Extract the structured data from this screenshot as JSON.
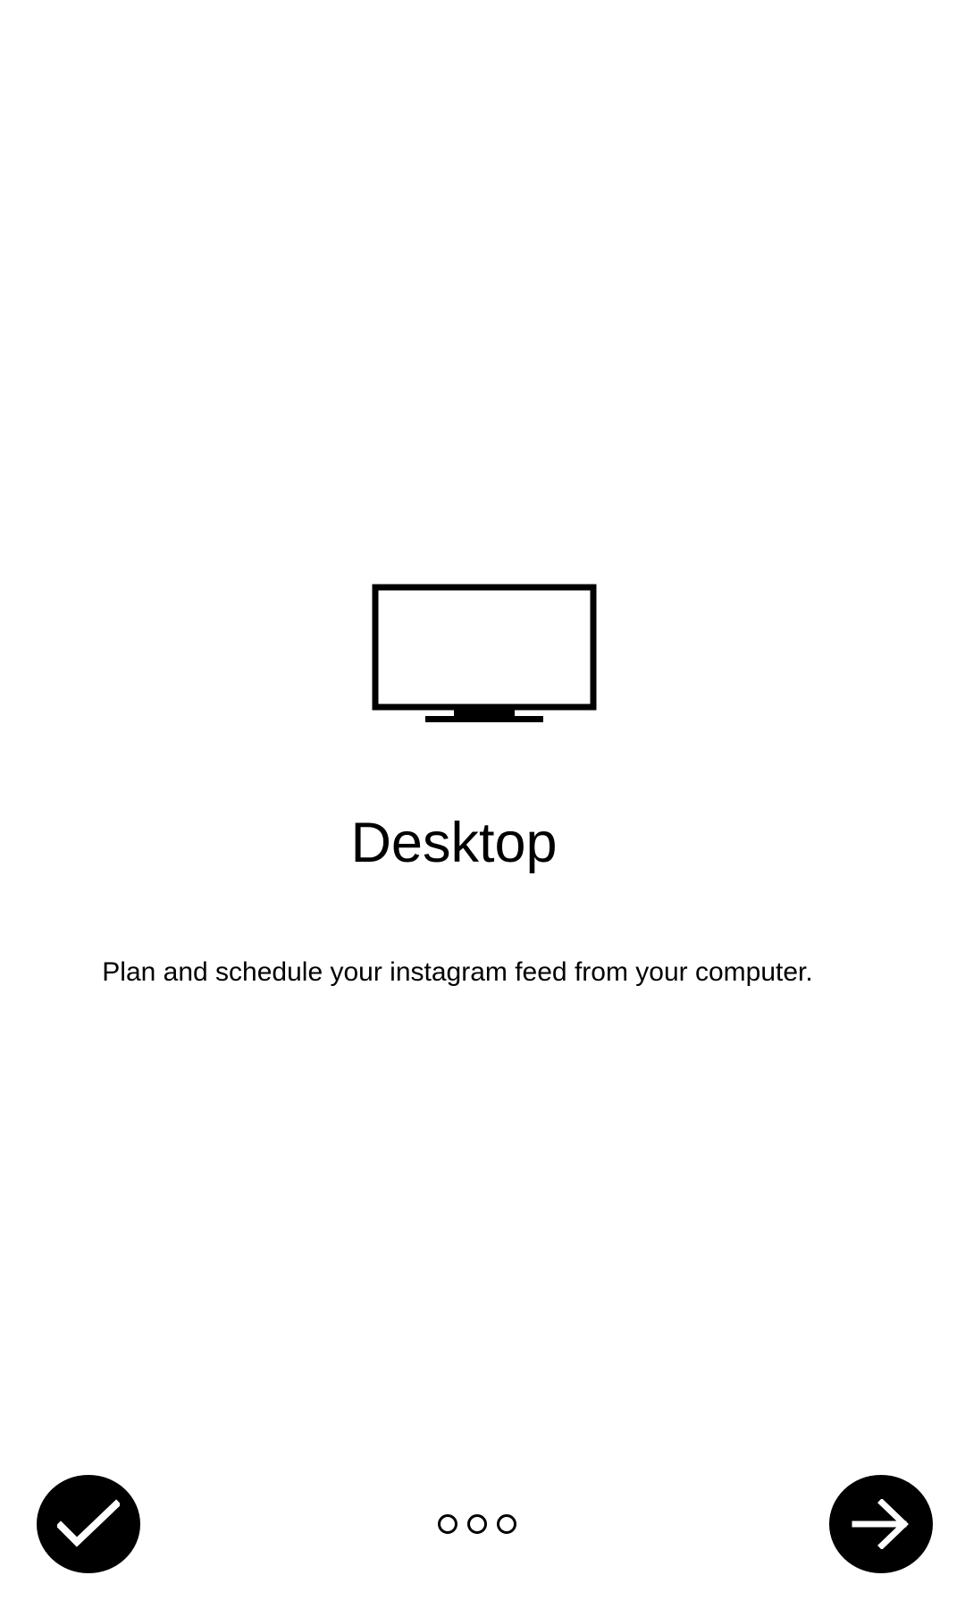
{
  "onboarding": {
    "icon": "monitor-icon",
    "title": "Desktop",
    "description": "Plan and schedule your instagram feed from your computer."
  },
  "footer": {
    "done_icon": "checkmark-icon",
    "next_icon": "arrow-right-icon",
    "page_count": 3
  },
  "colors": {
    "background": "#ffffff",
    "foreground": "#000000"
  }
}
